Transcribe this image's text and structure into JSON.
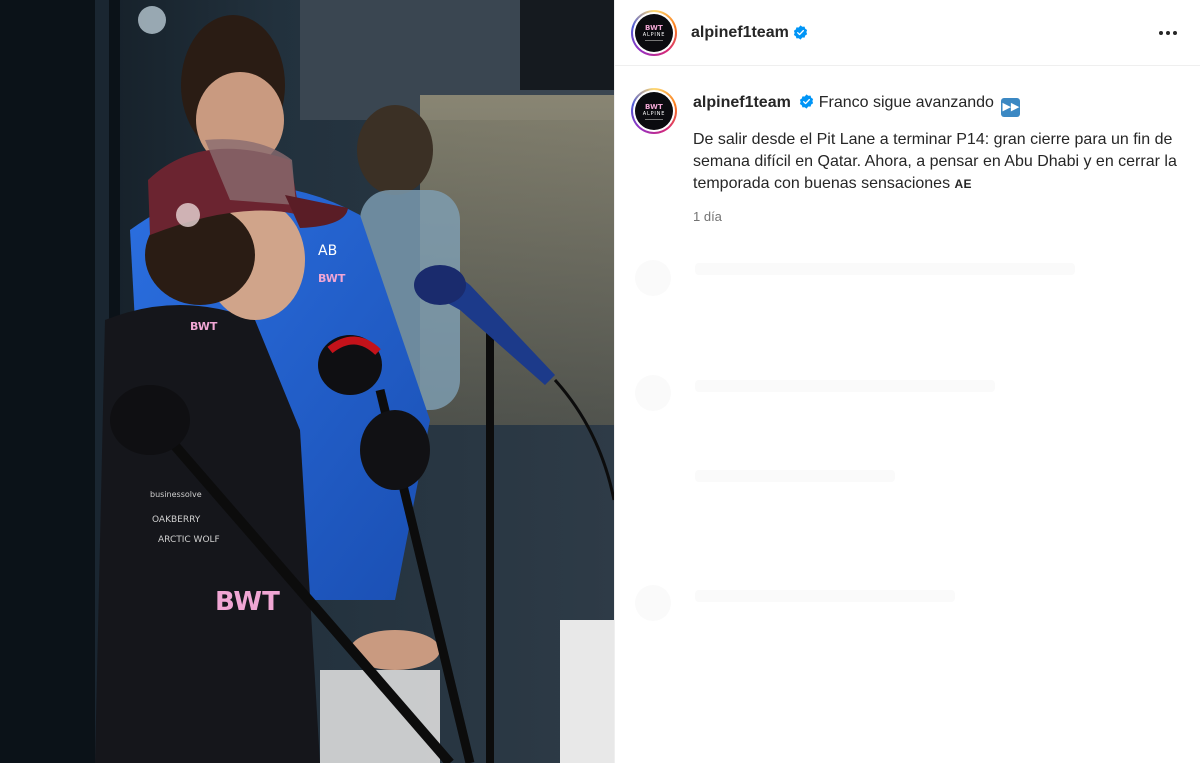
{
  "post": {
    "username": "alpinef1team",
    "verified": true,
    "avatar": {
      "brand_top": "BWT",
      "brand_bottom": "ALPINE"
    },
    "more_icon": "more-horizontal-icon",
    "caption": {
      "headline": "Franco sigue avanzando",
      "headline_emoji": "fast-forward-emoji",
      "body": "De salir desde el Pit Lane a terminar P14: gran cierre para un fin de semana difícil en Qatar. Ahora, a pensar en Abu Dhabi y en cerrar la temporada con buenas sensaciones",
      "signature_tag": "AE"
    },
    "timestamp": "1 día"
  },
  "photo": {
    "description_icon": "press-conference-photo",
    "cap_text": "",
    "colors": {
      "accent_pink": "#f0a6d4",
      "alpine_blue": "#1f63d6",
      "verified_blue": "#0095f6"
    }
  }
}
